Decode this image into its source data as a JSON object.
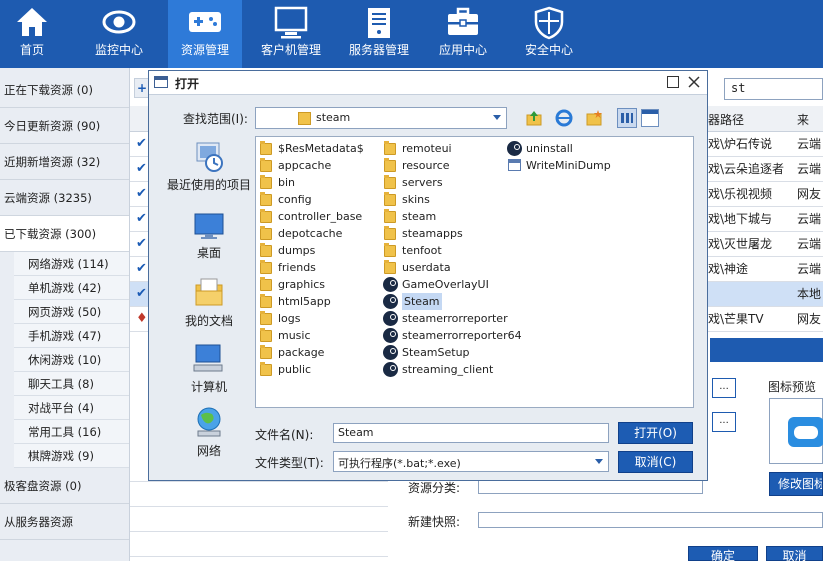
{
  "topnav": {
    "items": [
      {
        "label": "首页",
        "icon": "home-icon",
        "active": false
      },
      {
        "label": "监控中心",
        "icon": "eye-icon",
        "active": false
      },
      {
        "label": "资源管理",
        "icon": "gamepad-icon",
        "active": true
      },
      {
        "label": "客户机管理",
        "icon": "monitor-icon",
        "active": false
      },
      {
        "label": "服务器管理",
        "icon": "server-icon",
        "active": false
      },
      {
        "label": "应用中心",
        "icon": "toolbox-icon",
        "active": false
      },
      {
        "label": "安全中心",
        "icon": "shield-icon",
        "active": false
      }
    ]
  },
  "sidebar": {
    "main": [
      "正在下载资源 (0)",
      "今日更新资源 (90)",
      "近期新增资源 (32)",
      "云端资源 (3235)",
      "已下载资源 (300)"
    ],
    "sub": [
      "网络游戏 (114)",
      "单机游戏 (42)",
      "网页游戏 (50)",
      "手机游戏 (47)",
      "休闲游戏 (10)",
      "聊天工具 (8)",
      "对战平台 (4)",
      "常用工具 (16)",
      "棋牌游戏 (9)"
    ],
    "bottom": [
      "极客盘资源 (0)",
      "从服务器资源"
    ]
  },
  "background": {
    "search_value": "st",
    "header_path": "器路径",
    "header_source": "来",
    "rows": [
      {
        "path": "戏\\炉石传说",
        "source": "云端"
      },
      {
        "path": "戏\\云朵追逐者",
        "source": "云端"
      },
      {
        "path": "戏\\乐视视频",
        "source": "网友"
      },
      {
        "path": "戏\\地下城与",
        "source": "云端"
      },
      {
        "path": "戏\\灭世屠龙",
        "source": "云端"
      },
      {
        "path": "戏\\神途",
        "source": "云端"
      },
      {
        "path": "",
        "source": "本地"
      },
      {
        "path": "戏\\芒果TV",
        "source": "网友"
      }
    ],
    "icon_preview_label": "图标预览",
    "modify_icon_button": "修改图标",
    "category_label": "资源分类:",
    "snapshot_label": "新建快照:",
    "ellipsis": "...",
    "ok_button": "确定",
    "cancel_button": "取消"
  },
  "dialog": {
    "title": "打开",
    "lookin_label": "查找范围(I):",
    "lookin_value": "steam",
    "places": [
      "最近使用的项目",
      "桌面",
      "我的文档",
      "计算机",
      "网络"
    ],
    "files_col1": [
      "$ResMetadata$",
      "appcache",
      "bin",
      "config",
      "controller_base",
      "depotcache",
      "dumps",
      "friends",
      "graphics",
      "html5app",
      "logs",
      "music",
      "package",
      "public"
    ],
    "files_col2": [
      {
        "name": "remoteui",
        "type": "folder"
      },
      {
        "name": "resource",
        "type": "folder"
      },
      {
        "name": "servers",
        "type": "folder"
      },
      {
        "name": "skins",
        "type": "folder"
      },
      {
        "name": "steam",
        "type": "folder"
      },
      {
        "name": "steamapps",
        "type": "folder"
      },
      {
        "name": "tenfoot",
        "type": "folder"
      },
      {
        "name": "userdata",
        "type": "folder"
      },
      {
        "name": "GameOverlayUI",
        "type": "steam"
      },
      {
        "name": "Steam",
        "type": "steam",
        "selected": true
      },
      {
        "name": "steamerrorreporter",
        "type": "steam"
      },
      {
        "name": "steamerrorreporter64",
        "type": "steam"
      },
      {
        "name": "SteamSetup",
        "type": "steam"
      },
      {
        "name": "streaming_client",
        "type": "steam"
      }
    ],
    "files_col3": [
      {
        "name": "uninstall",
        "type": "steam"
      },
      {
        "name": "WriteMiniDump",
        "type": "generic"
      }
    ],
    "filename_label": "文件名(N):",
    "filename_value": "Steam",
    "filetype_label": "文件类型(T):",
    "filetype_value": "可执行程序(*.bat;*.exe)",
    "open_button": "打开(O)",
    "cancel_button": "取消(C)"
  },
  "colors": {
    "nav_bg": "#1e5bb0",
    "nav_active": "#2e7ad8",
    "button_blue": "#1d5cb3"
  }
}
